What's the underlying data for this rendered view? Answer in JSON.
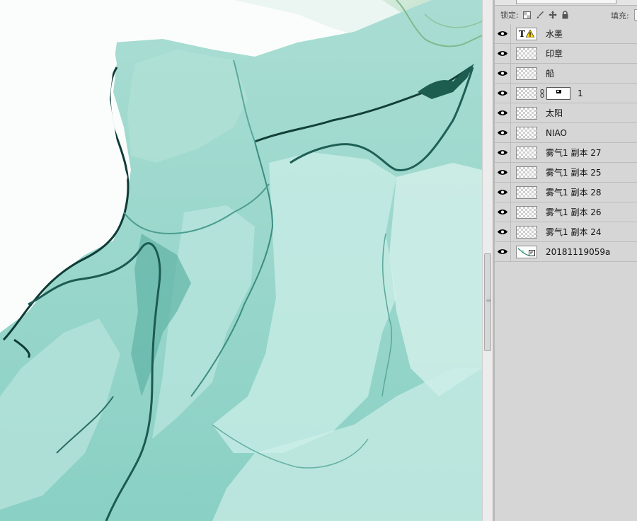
{
  "toolbar": {
    "lock_label": "锁定:",
    "lock_icons": [
      "lock-transparent-icon",
      "lock-paint-brush-icon",
      "lock-move-icon",
      "lock-all-icon"
    ],
    "fill_label": "填充:"
  },
  "layers": [
    {
      "name": "水墨",
      "thumb": "text-warning",
      "visible": true
    },
    {
      "name": "印章",
      "thumb": "transparent",
      "visible": true
    },
    {
      "name": "船",
      "thumb": "transparent",
      "visible": true
    },
    {
      "name": "1",
      "thumb": "transparent-with-mask",
      "visible": true
    },
    {
      "name": "太阳",
      "thumb": "transparent",
      "visible": true
    },
    {
      "name": "NIAO",
      "thumb": "transparent",
      "visible": true
    },
    {
      "name": "雾气1 副本 27",
      "thumb": "transparent",
      "visible": true
    },
    {
      "name": "雾气1 副本 25",
      "thumb": "transparent",
      "visible": true
    },
    {
      "name": "雾气1 副本 28",
      "thumb": "transparent",
      "visible": true
    },
    {
      "name": "雾气1 副本 26",
      "thumb": "transparent",
      "visible": true
    },
    {
      "name": "雾气1 副本 24",
      "thumb": "transparent",
      "visible": true
    },
    {
      "name": "20181119059a",
      "thumb": "image",
      "visible": true
    }
  ],
  "colors": {
    "ink_light": "#c6ebe5",
    "ink_mid": "#8fd3c7",
    "ink_dark": "#3f9e90",
    "ink_darkest": "#0f3b36",
    "ink_green": "#7fb98e",
    "panel_bg": "#d6d6d6"
  }
}
